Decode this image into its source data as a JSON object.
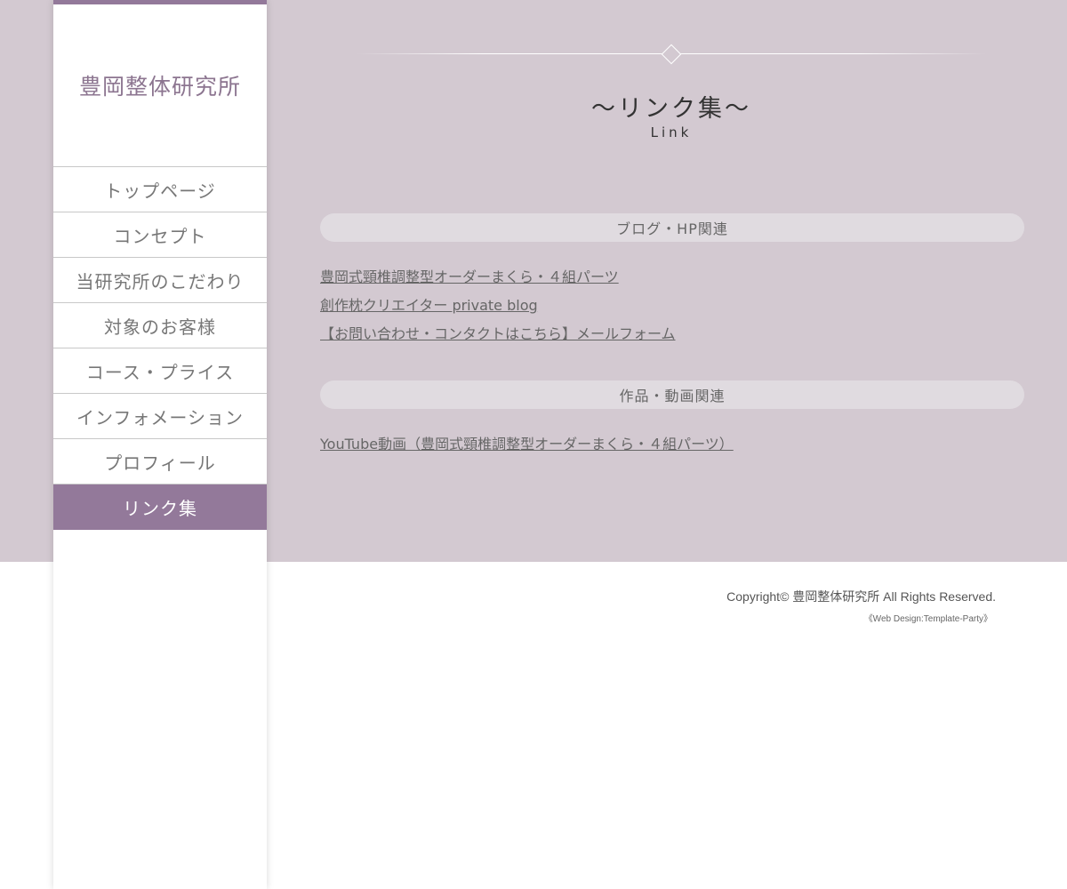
{
  "site": {
    "logo": "豊岡整体研究所"
  },
  "nav": {
    "items": [
      {
        "label": "トップページ"
      },
      {
        "label": "コンセプト"
      },
      {
        "label": "当研究所のこだわり"
      },
      {
        "label": "対象のお客様"
      },
      {
        "label": "コース・プライス"
      },
      {
        "label": "インフォメーション"
      },
      {
        "label": "プロフィール"
      },
      {
        "label": "リンク集",
        "active": true
      }
    ]
  },
  "main": {
    "title": "～リンク集～",
    "subtitle": "Link",
    "sections": [
      {
        "heading": "ブログ・HP関連",
        "links": [
          "豊岡式頸椎調整型オーダーまくら・４組パーツ",
          "創作枕クリエイター private blog",
          "【お問い合わせ・コンタクトはこちら】メールフォーム"
        ]
      },
      {
        "heading": "作品・動画関連",
        "links": [
          "YouTube動画（豊岡式頸椎調整型オーダーまくら・４組パーツ）"
        ]
      }
    ]
  },
  "footer": {
    "copyright": "Copyright© 豊岡整体研究所 All Rights Reserved.",
    "credit": "《Web Design:Template-Party》"
  },
  "colors": {
    "accent": "#93799a",
    "band": "#d3c9d1",
    "heading_pill": "#e0dbe0"
  }
}
